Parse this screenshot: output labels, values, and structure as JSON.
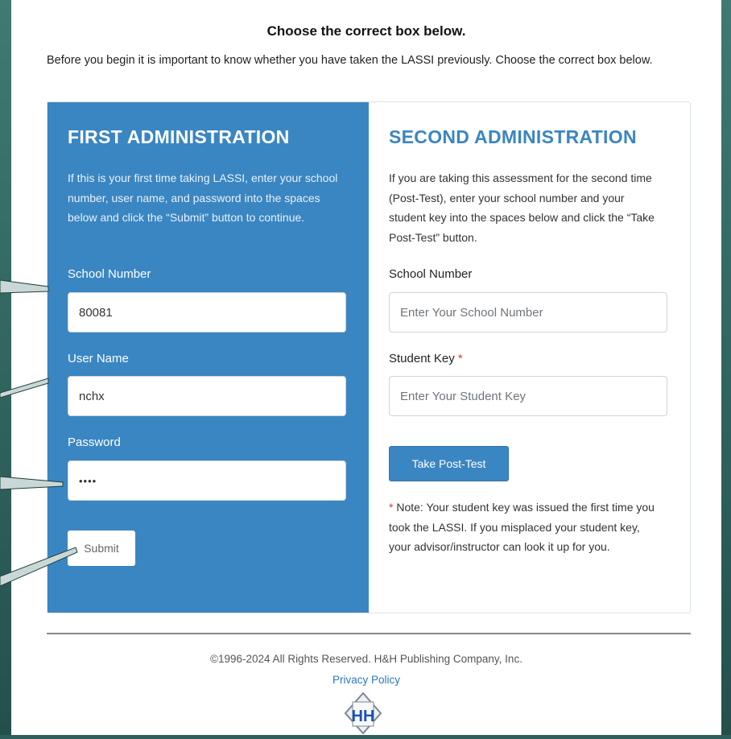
{
  "heading": "Choose the correct box below.",
  "intro": "Before you begin it is important to know whether you have taken the LASSI previously. Choose the correct box below.",
  "first": {
    "title": "FIRST ADMINISTRATION",
    "description": "If this is your first time taking LASSI, enter your school number, user name, and password into the spaces below and click the “Submit” button to continue.",
    "school_label": "School Number",
    "school_value": "80081",
    "username_label": "User Name",
    "username_value": "nchx",
    "password_label": "Password",
    "password_value": "••••",
    "submit_label": "Submit"
  },
  "second": {
    "title": "SECOND ADMINISTRATION",
    "description": "If you are taking this assessment for the second time (Post-Test), enter your school number and your student key into the spaces below and click the “Take Post-Test” button.",
    "school_label": "School Number",
    "school_placeholder": "Enter Your School Number",
    "key_label": "Student Key",
    "required_mark": "*",
    "key_placeholder": "Enter Your Student Key",
    "button_label": "Take Post-Test",
    "note_mark": "*",
    "note": "Note: Your student key was issued the first time you took the LASSI. If you misplaced your student key, your advisor/instructor can look it up for you."
  },
  "footer": {
    "copyright": "©1996-2024 All Rights Reserved. H&H Publishing Company, Inc.",
    "privacy": "Privacy Policy",
    "logo_text": "HH"
  },
  "colors": {
    "primary": "#3a86c2",
    "background": "#2f5f5c",
    "required": "#d23b3b"
  }
}
